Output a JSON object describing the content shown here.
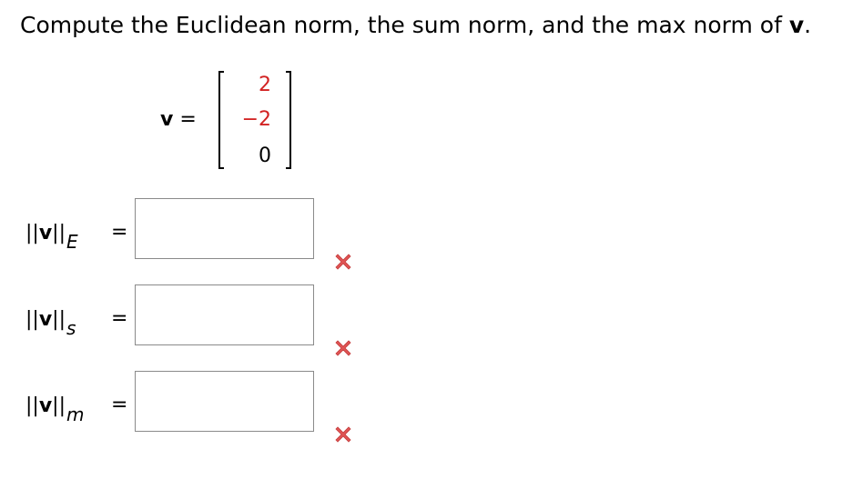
{
  "question": {
    "text": "Compute the Euclidean norm, the sum norm, and the max norm of ",
    "bold_tail": "v",
    "end": "."
  },
  "vector": {
    "name": "v",
    "equals": "=",
    "entries": [
      "2",
      "−2",
      "0"
    ],
    "entry_colors": [
      "#d22222",
      "#d22222",
      "#000000"
    ]
  },
  "norms": [
    {
      "bars_open": "||",
      "name": "v",
      "bars_close": "||",
      "subscript": "E",
      "equals": "=",
      "value": "",
      "status": "incorrect"
    },
    {
      "bars_open": "||",
      "name": "v",
      "bars_close": "||",
      "subscript": "s",
      "equals": "=",
      "value": "",
      "status": "incorrect"
    },
    {
      "bars_open": "||",
      "name": "v",
      "bars_close": "||",
      "subscript": "m",
      "equals": "=",
      "value": "",
      "status": "incorrect"
    }
  ],
  "colors": {
    "incorrect_mark": "#e05555",
    "highlight_entry": "#d22222"
  },
  "icons": {
    "status_incorrect": "cross-icon"
  }
}
